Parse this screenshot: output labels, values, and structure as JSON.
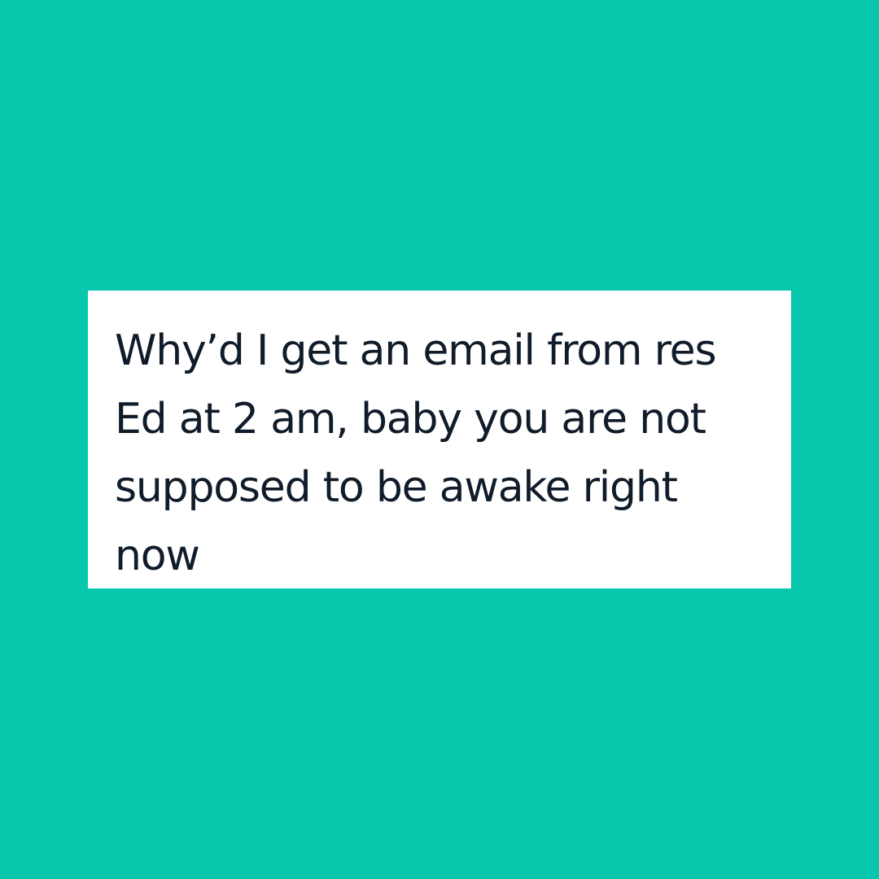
{
  "theme": {
    "background_color": "#07c8ad",
    "card_color": "#ffffff",
    "text_color": "#101c2a"
  },
  "quote": {
    "lines": [
      "Why’d I get an email from res",
      "Ed at 2 am, baby you are not",
      "supposed to be awake right",
      "now"
    ]
  }
}
